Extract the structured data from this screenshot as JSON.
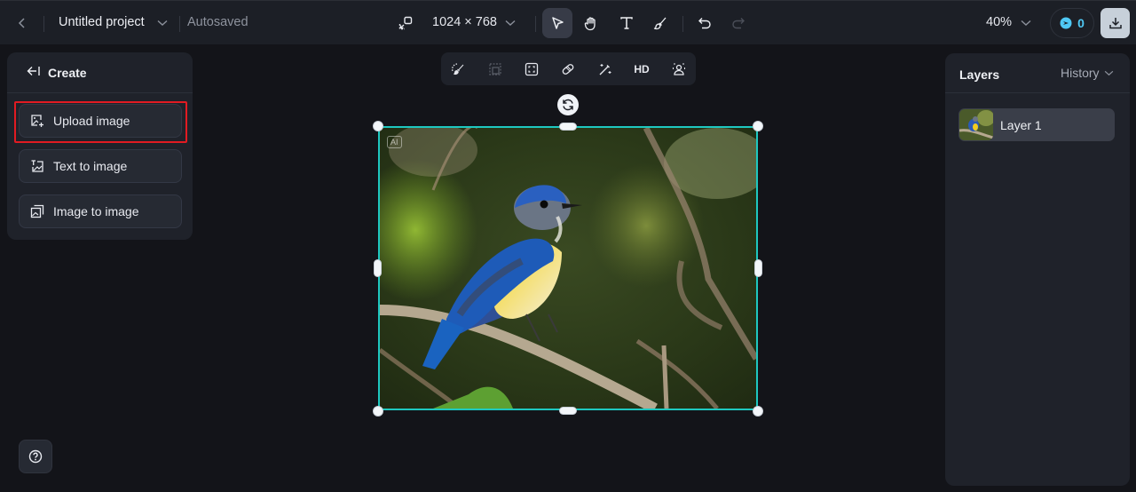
{
  "topbar": {
    "back_icon": "chevron-left-icon",
    "project_title": "Untitled project",
    "title_dropdown_icon": "chevron-down-icon",
    "save_status": "Autosaved",
    "resize_icon": "resize-canvas-icon",
    "canvas_size": "1024 × 768",
    "size_dropdown_icon": "chevron-down-icon",
    "tools": [
      {
        "name": "select",
        "icon": "cursor-arrow-icon",
        "active": true
      },
      {
        "name": "hand",
        "icon": "hand-icon",
        "active": false
      },
      {
        "name": "text",
        "icon": "text-icon",
        "active": false
      },
      {
        "name": "brush",
        "icon": "brush-icon",
        "active": false
      }
    ],
    "undo_icon": "undo-icon",
    "redo_icon": "redo-icon",
    "zoom_level": "40%",
    "credits": "0",
    "credits_icon": "credit-icon",
    "download_icon": "download-icon"
  },
  "create_panel": {
    "header": "Create",
    "collapse_icon": "collapse-left-icon",
    "items": [
      {
        "label": "Upload image",
        "icon": "upload-image-icon",
        "highlighted": true
      },
      {
        "label": "Text to image",
        "icon": "text-to-image-icon",
        "highlighted": false
      },
      {
        "label": "Image to image",
        "icon": "image-to-image-icon",
        "highlighted": false
      }
    ],
    "highlight_color": "#e11b22"
  },
  "float_toolbar": {
    "items": [
      {
        "name": "retouch",
        "icon": "magic-brush-icon"
      },
      {
        "name": "expand",
        "icon": "expand-frame-icon",
        "disabled": true
      },
      {
        "name": "crop",
        "icon": "crop-icon"
      },
      {
        "name": "eraser",
        "icon": "eraser-icon"
      },
      {
        "name": "magic-wand",
        "icon": "magic-wand-icon"
      },
      {
        "name": "upscale",
        "label": "HD"
      },
      {
        "name": "remove-background",
        "icon": "person-cutout-icon"
      }
    ]
  },
  "canvas": {
    "badge": "AI",
    "selection_color": "#1ec8c0",
    "rotate_icon": "rotate-icon",
    "image_description": "Blue and yellow bird perched on a branch"
  },
  "layers_panel": {
    "title": "Layers",
    "history_label": "History",
    "layers": [
      {
        "name": "Layer 1"
      }
    ]
  },
  "help_icon": "help-circle-icon"
}
